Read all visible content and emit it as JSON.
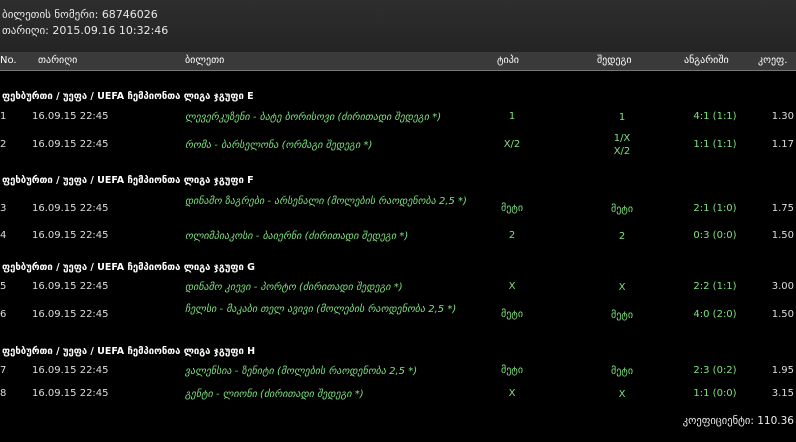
{
  "ticket": {
    "number_label": "ბილეთის ნომერი:",
    "number": "68746026",
    "date_label": "თარიღი:",
    "date": "2015.09.16 10:32:46"
  },
  "headers": {
    "no": "No.",
    "date": "თარიღი",
    "ticket": "ბილეთი",
    "type": "ტიპი",
    "result": "შედეგი",
    "score": "ანგარიში",
    "coef": "კოეფ."
  },
  "groups": [
    {
      "title": "ფეხბურთი / უეფა / UEFA ჩემპიონთა ლიგა ჯგუფი E",
      "rows": [
        {
          "no": "1",
          "date": "16.09.15 22:45",
          "event": "ლევერკუზენი - ბატე ბორისოვი (ძირითადი შედეგი *)",
          "type": "1",
          "result": "1",
          "score": "4:1 (1:1)",
          "coef": "1.30"
        },
        {
          "no": "2",
          "date": "16.09.15 22:45",
          "event": "რომა - ბარსელონა (ორმაგი შედეგი *)",
          "type": "X/2",
          "result": "1/X\nX/2",
          "score": "1:1 (1:1)",
          "coef": "1.17"
        }
      ]
    },
    {
      "title": "ფეხბურთი / უეფა / UEFA ჩემპიონთა ლიგა ჯგუფი F",
      "rows": [
        {
          "no": "3",
          "date": "16.09.15 22:45",
          "event": "დინამო ზაგრები - არსენალი (მოლების რაოდენობა 2,5 *)",
          "type": "მეტი",
          "result": "მეტი",
          "score": "2:1 (1:0)",
          "coef": "1.75"
        },
        {
          "no": "4",
          "date": "16.09.15 22:45",
          "event": "ოლიმპიაკოსი - ბაიერნი (ძირითადი შედეგი *)",
          "type": "2",
          "result": "2",
          "score": "0:3 (0:0)",
          "coef": "1.50"
        }
      ]
    },
    {
      "title": "ფეხბურთი / უეფა / UEFA ჩემპიონთა ლიგა ჯგუფი G",
      "rows": [
        {
          "no": "5",
          "date": "16.09.15 22:45",
          "event": "დინამო კიევი - პორტო (ძირითადი შედეგი *)",
          "type": "X",
          "result": "X",
          "score": "2:2 (1:1)",
          "coef": "3.00"
        },
        {
          "no": "6",
          "date": "16.09.15 22:45",
          "event": "ჩელსი - მაკაბი თელ ავივი (მოლების რაოდენობა 2,5 *)",
          "type": "მეტი",
          "result": "მეტი",
          "score": "4:0 (2:0)",
          "coef": "1.50"
        }
      ]
    },
    {
      "title": "ფეხბურთი / უეფა / UEFA ჩემპიონთა ლიგა ჯგუფი H",
      "rows": [
        {
          "no": "7",
          "date": "16.09.15 22:45",
          "event": "ვალენსია - ზენიტი (მოლების რაოდენობა 2,5 *)",
          "type": "მეტი",
          "result": "მეტი",
          "score": "2:3 (0:2)",
          "coef": "1.95"
        },
        {
          "no": "8",
          "date": "16.09.15 22:45",
          "event": "გენტი - ლიონი (ძირითადი შედეგი *)",
          "type": "X",
          "result": "X",
          "score": "1:1 (0:0)",
          "coef": "3.15"
        }
      ]
    }
  ],
  "total": {
    "label": "კოეფიციენტი:",
    "value": "110.36"
  }
}
